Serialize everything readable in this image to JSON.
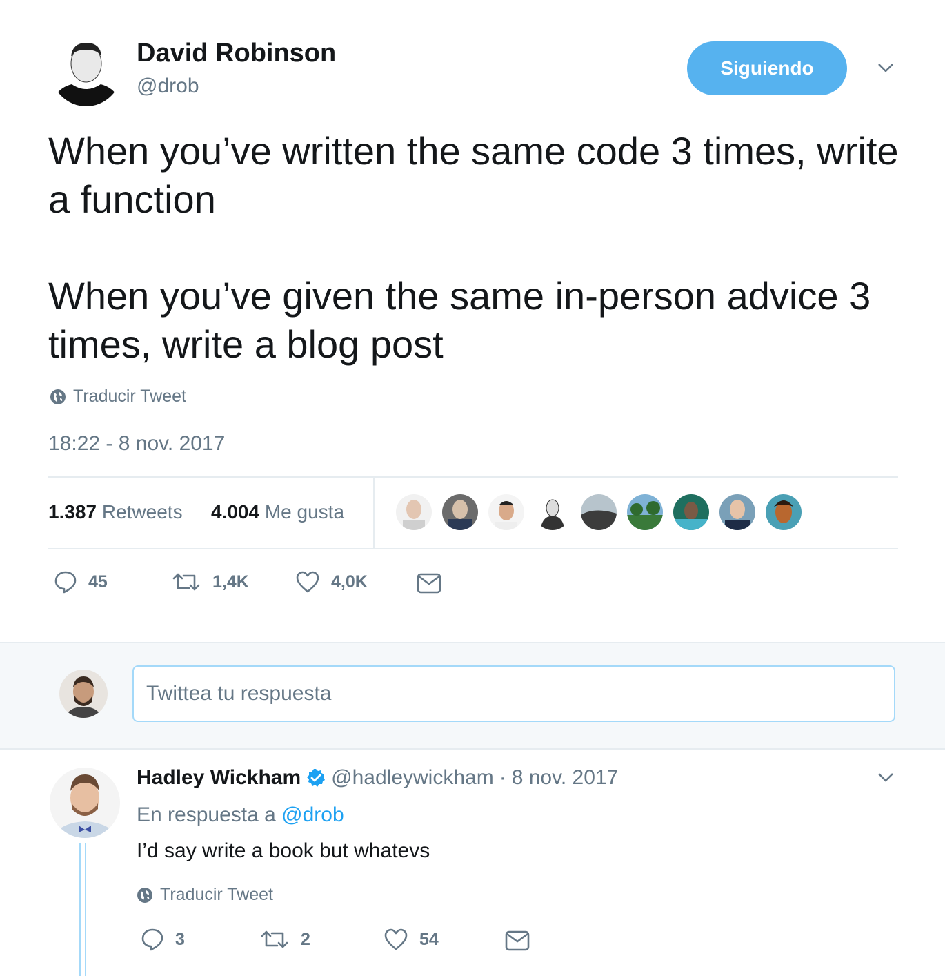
{
  "tweet": {
    "author_name": "David Robinson",
    "author_handle": "@drob",
    "follow_label": "Siguiendo",
    "paragraphs": [
      "When you’ve written the same code 3 times, write a function",
      "When you’ve given the same in-person advice 3 times, write a blog post"
    ],
    "translate_label": "Traducir Tweet",
    "timestamp": "18:22 - 8 nov. 2017",
    "stats": {
      "retweets_count": "1.387",
      "retweets_label": "Retweets",
      "likes_count": "4.004",
      "likes_label": "Me gusta"
    },
    "liker_avatars": [
      "avatar-1",
      "avatar-2",
      "avatar-3",
      "avatar-4",
      "avatar-5",
      "avatar-6",
      "avatar-7",
      "avatar-8",
      "avatar-9"
    ],
    "actions": {
      "replies": "45",
      "retweets": "1,4K",
      "likes": "4,0K"
    }
  },
  "reply_composer": {
    "placeholder": "Twittea tu respuesta"
  },
  "reply": {
    "author_name": "Hadley Wickham",
    "author_handle": "@hadleywickham",
    "separator": "·",
    "date": "8 nov. 2017",
    "in_reply_prefix": "En respuesta a",
    "in_reply_handle": "@drob",
    "text": "I’d say write a book but whatevs",
    "translate_label": "Traducir Tweet",
    "actions": {
      "replies": "3",
      "retweets": "2",
      "likes": "54"
    }
  },
  "colors": {
    "accent": "#1da1f2",
    "follow_button": "#56b2ef",
    "muted_text": "#657786",
    "divider": "#e6ecf0",
    "reply_band": "#f5f8fa"
  }
}
